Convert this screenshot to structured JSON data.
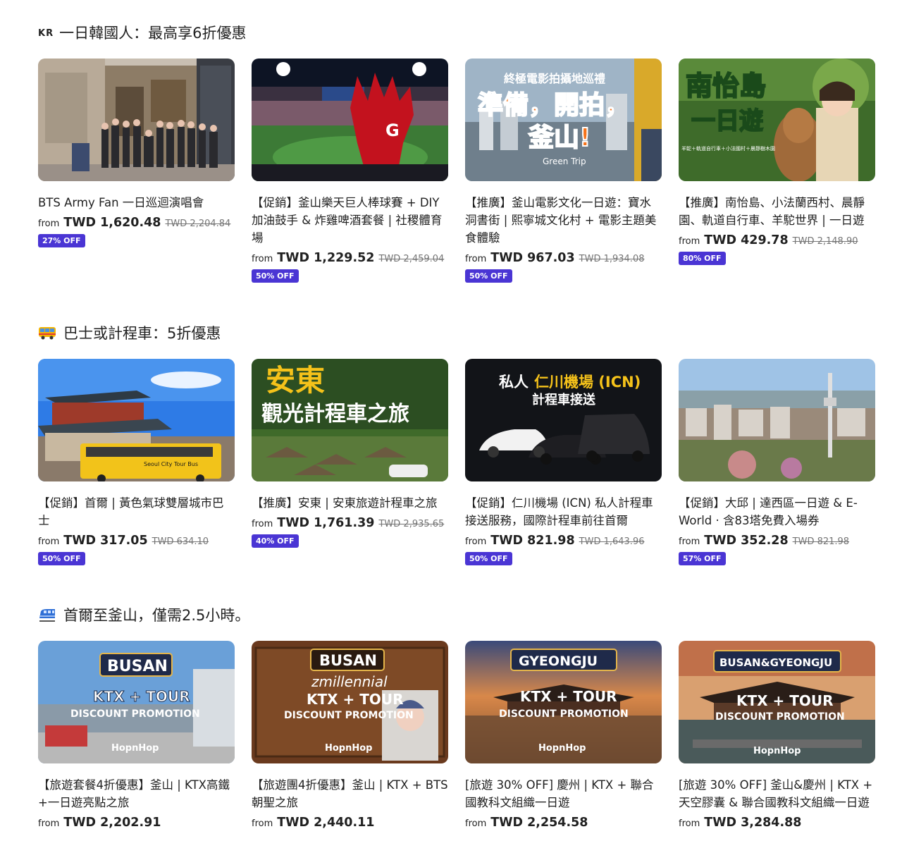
{
  "sections": [
    {
      "flag": "KR",
      "title": "一日韓國人：最高享6折優惠",
      "cards": [
        {
          "title": "BTS Army Fan 一日巡迴演唱會",
          "from": "from",
          "price": "TWD 1,620.48",
          "old_price": "TWD 2,204.84",
          "badge": "27% OFF",
          "img": {
            "overlay": [],
            "scene": "street"
          }
        },
        {
          "title": "【促銷】釜山樂天巨人棒球賽 + DIY 加油鼓手 & 炸雞啤酒套餐 | 社稷體育場",
          "from": "from",
          "price": "TWD 1,229.52",
          "old_price": "TWD 2,459.04",
          "badge": "50% OFF",
          "img": {
            "overlay": [],
            "scene": "stadium"
          }
        },
        {
          "title": "【推廣】釜山電影文化一日遊：寶水洞書街 | 熙寧城文化村 + 電影主題美食體驗",
          "from": "from",
          "price": "TWD 967.03",
          "old_price": "TWD 1,934.08",
          "badge": "50% OFF",
          "img": {
            "overlay": [
              "終極電影拍攝地巡禮",
              "準備，開拍，",
              "釜山!",
              "Green Trip"
            ],
            "scene": "busan"
          }
        },
        {
          "title": "【推廣】南怡島、小法蘭西村、晨靜園、軌道自行車、羊駝世界 | 一日遊",
          "from": "from",
          "price": "TWD 429.78",
          "old_price": "TWD 2,148.90",
          "badge": "80% OFF",
          "img": {
            "overlay": [
              "南怡島",
              "一日遊",
              "羊駝＋軌道自行車＋小法國村＋晨靜樹木園"
            ],
            "scene": "nami"
          }
        }
      ]
    },
    {
      "flag": "",
      "title": "巴士或計程車：5折優惠",
      "cards": [
        {
          "title": "【促銷】首爾 | 黃色氣球雙層城市巴士",
          "from": "from",
          "price": "TWD 317.05",
          "old_price": "TWD 634.10",
          "badge": "50% OFF",
          "img": {
            "overlay": [
              "Seoul City Tour Bus"
            ],
            "scene": "palace"
          }
        },
        {
          "title": "【推廣】安東 | 安東旅遊計程車之旅",
          "from": "from",
          "price": "TWD 1,761.39",
          "old_price": "TWD 2,935.65",
          "badge": "40% OFF",
          "img": {
            "overlay": [
              "安東",
              "觀光計程車之旅"
            ],
            "scene": "andong"
          }
        },
        {
          "title": "【促銷】仁川機場 (ICN) 私人計程車接送服務，國際計程車前往首爾",
          "from": "from",
          "price": "TWD 821.98",
          "old_price": "TWD 1,643.96",
          "badge": "50% OFF",
          "img": {
            "overlay": [
              "私人",
              "仁川機場 (ICN)",
              "計程車接送"
            ],
            "scene": "taxi"
          }
        },
        {
          "title": "【促銷】大邱 | 達西區一日遊 & E-World · 含83塔免費入場券",
          "from": "from",
          "price": "TWD 352.28",
          "old_price": "TWD 821.98",
          "badge": "57% OFF",
          "img": {
            "overlay": [],
            "scene": "daegu"
          }
        }
      ]
    },
    {
      "flag": "",
      "title": "首爾至釜山，僅需2.5小時。",
      "cards": [
        {
          "title": "【旅遊套餐4折優惠】釜山 | KTX高鐵+一日遊亮點之旅",
          "from": "from",
          "price": "TWD 2,202.91",
          "old_price": "",
          "badge": "",
          "img": {
            "overlay": [
              "BUSAN",
              "KTX + TOUR",
              "DISCOUNT PROMOTION",
              "HopnHop"
            ],
            "scene": "ktx1"
          }
        },
        {
          "title": "【旅遊團4折優惠】釜山 | KTX + BTS 朝聖之旅",
          "from": "from",
          "price": "TWD 2,440.11",
          "old_price": "",
          "badge": "",
          "img": {
            "overlay": [
              "BUSAN",
              "zmillennial",
              "KTX + TOUR",
              "DISCOUNT PROMOTION",
              "HopnHop"
            ],
            "scene": "ktx2"
          }
        },
        {
          "title": "[旅遊 30% OFF] 慶州 | KTX + 聯合國教科文組織一日遊",
          "from": "from",
          "price": "TWD 2,254.58",
          "old_price": "",
          "badge": "",
          "img": {
            "overlay": [
              "GYEONGJU",
              "KTX + TOUR",
              "DISCOUNT PROMOTION",
              "HopnHop"
            ],
            "scene": "ktx3"
          }
        },
        {
          "title": "[旅遊 30% OFF] 釜山&慶州 | KTX + 天空膠囊 & 聯合國教科文組織一日遊",
          "from": "from",
          "price": "TWD 3,284.88",
          "old_price": "",
          "badge": "",
          "img": {
            "overlay": [
              "BUSAN&GYEONGJU",
              "KTX + TOUR",
              "DISCOUNT PROMOTION",
              "HopnHop"
            ],
            "scene": "ktx4"
          }
        }
      ]
    }
  ]
}
